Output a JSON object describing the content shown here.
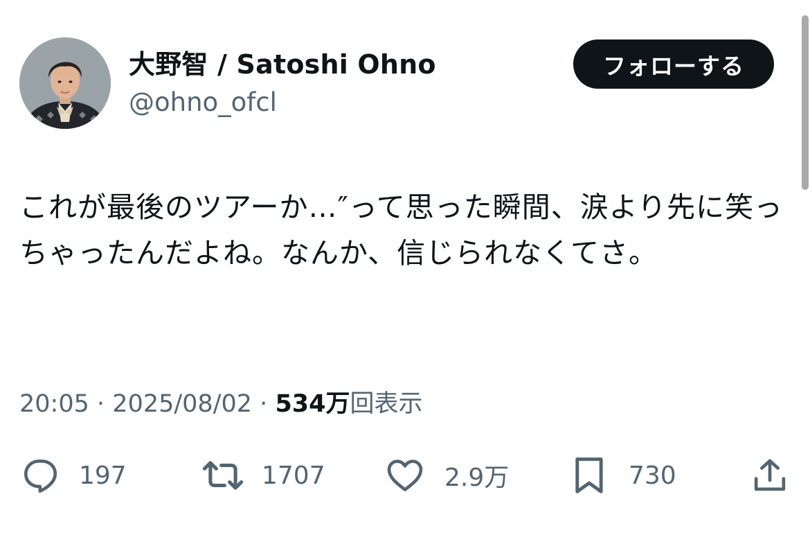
{
  "author": {
    "display_name": "大野智 / Satoshi Ohno",
    "handle": "@ohno_ofcl"
  },
  "follow_button_label": "フォローする",
  "tweet": {
    "text": "これが最後のツアーか…″って思った瞬間、涙より先に笑っちゃったんだよね。なんか、信じられなくてさ。"
  },
  "meta": {
    "time": "20:05",
    "separator": "·",
    "date": "2025/08/02",
    "views_count": "534万",
    "views_label": "回表示"
  },
  "actions": {
    "reply_count": "197",
    "retweet_count": "1707",
    "like_count": "2.9万",
    "bookmark_count": "730"
  },
  "icons": {
    "reply": "reply-bubble-icon",
    "retweet": "retweet-arrows-icon",
    "like": "heart-icon",
    "bookmark": "bookmark-icon",
    "share": "share-upload-icon"
  },
  "colors": {
    "text_primary": "#0f1419",
    "text_secondary": "#536471",
    "button_bg": "#0f1419",
    "button_text": "#ffffff"
  }
}
